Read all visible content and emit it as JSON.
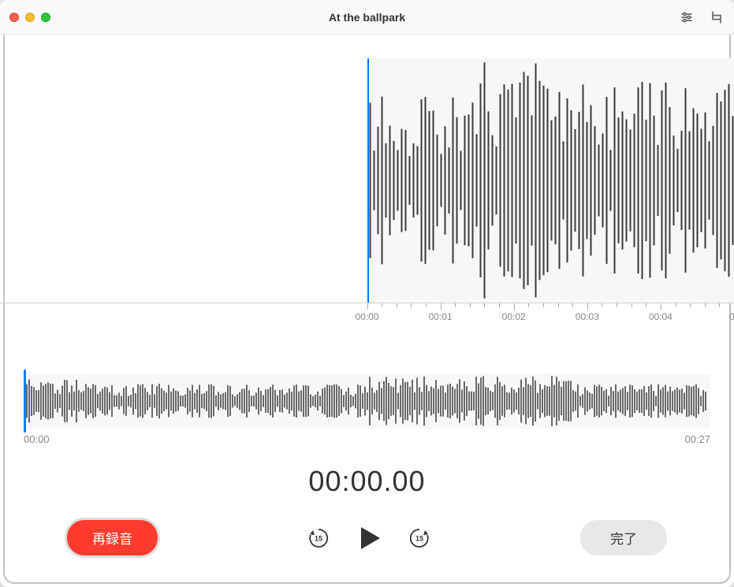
{
  "window": {
    "title": "At the ballpark"
  },
  "main_waveform": {
    "playhead_pct": 50.0,
    "ruler_ticks": [
      "00:00",
      "00:01",
      "00:02",
      "00:03",
      "00:04"
    ],
    "ruler_partial": "0"
  },
  "overview": {
    "start_label": "00:00",
    "end_label": "00:27",
    "playhead_pct": 0
  },
  "timecode": "00:00.00",
  "controls": {
    "record_label": "再録音",
    "done_label": "完了",
    "skip_amount": "15"
  },
  "colors": {
    "accent": "#007aff",
    "record": "#ff3b30"
  }
}
